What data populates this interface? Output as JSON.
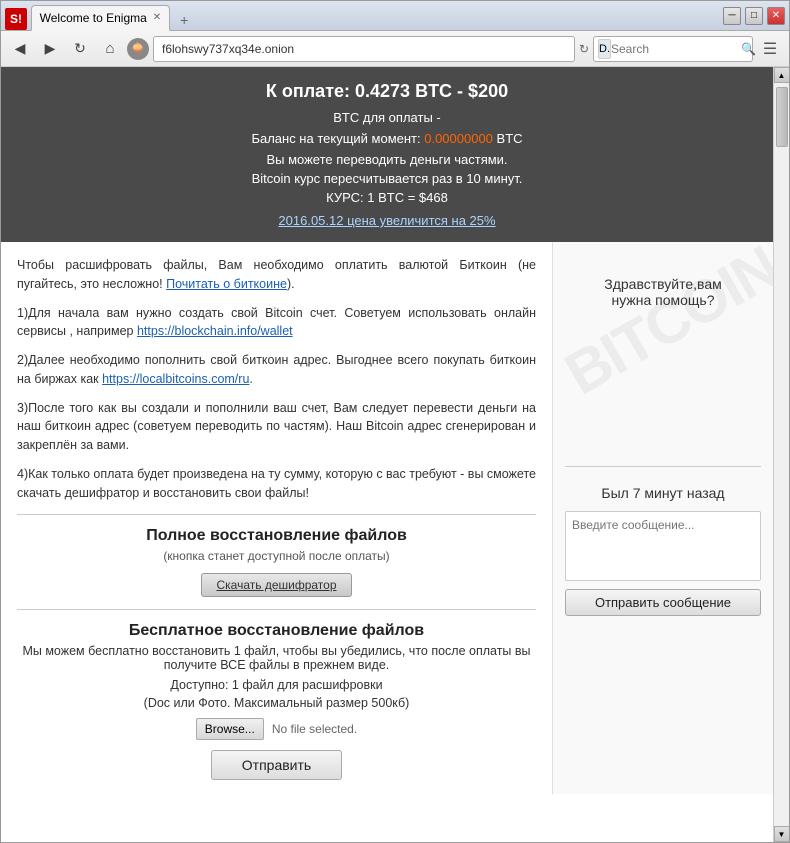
{
  "window": {
    "title": "Welcome to Enigma",
    "tab_label": "Welcome to Enigma"
  },
  "toolbar": {
    "address": "f6lohswy737xq34e.onion",
    "search_placeholder": "Search",
    "search_label": "Search"
  },
  "header": {
    "title": "К оплате: 0.4273 BTC - $200",
    "btc_label": "BTC для оплаты -",
    "balance_label": "Баланс на текущий момент:",
    "balance_value": "0.00000000",
    "balance_unit": "BTC",
    "can_transfer": "Вы можете переводить деньги частями.",
    "recalc_info": "Bitcoin курс пересчитывается раз в 10 минут.",
    "course_label": "КУРС: 1 BTC = $468",
    "date_link": "2016.05.12 цена увеличится на 25%"
  },
  "instructions": {
    "intro": "Чтобы расшифровать файлы, Вам необходимо оплатить валютой Биткоин (не пугайтесь, это несложно!",
    "read_about": "Почитать о биткоине",
    "step1": "1)Для начала вам нужно создать свой Bitcoin счет. Советуем использовать онлайн сервисы , например",
    "step1_link": "https://blockchain.info/wallet",
    "step2_text": "2)Далее необходимо пополнить свой биткоин адрес. Выгоднее всего покупать биткоин на биржах как",
    "step2_link": "https://localbitcoins.com/ru",
    "step3": "3)После того как вы создали и пополнили ваш счет, Вам следует перевести деньги на наш биткоин адрес (советуем переводить по частям). Наш Bitcoin адрес сгенерирован и закреплён за вами.",
    "step4": "4)Как только оплата будет произведена на ту сумму, которую с вас требуют - вы сможете скачать дешифратор и восстановить свои файлы!"
  },
  "full_recovery": {
    "title": "Полное восстановление файлов",
    "subtitle": "(кнопка станет доступной после оплаты)",
    "button": "Скачать дешифратор"
  },
  "free_recovery": {
    "title": "Бесплатное восстановление файлов",
    "description": "Мы можем бесплатно восстановить 1 файл, чтобы вы убедились, что после оплаты вы получите ВСЕ файлы в прежнем виде.",
    "available": "Доступно: 1 файл для расшифровки",
    "file_types": "(Doc или Фото. Максимальный размер 500кб)",
    "browse_label": "Browse...",
    "file_selected": "No file selected.",
    "submit_label": "Отправить"
  },
  "chat": {
    "greeting": "Здравствуйте,вам\nнужна помощь?",
    "last_seen": "Был 7 минут назад",
    "message_placeholder": "Введите сообщение...",
    "send_button": "Отправить сообщение"
  },
  "watermark": "BITCOIN"
}
